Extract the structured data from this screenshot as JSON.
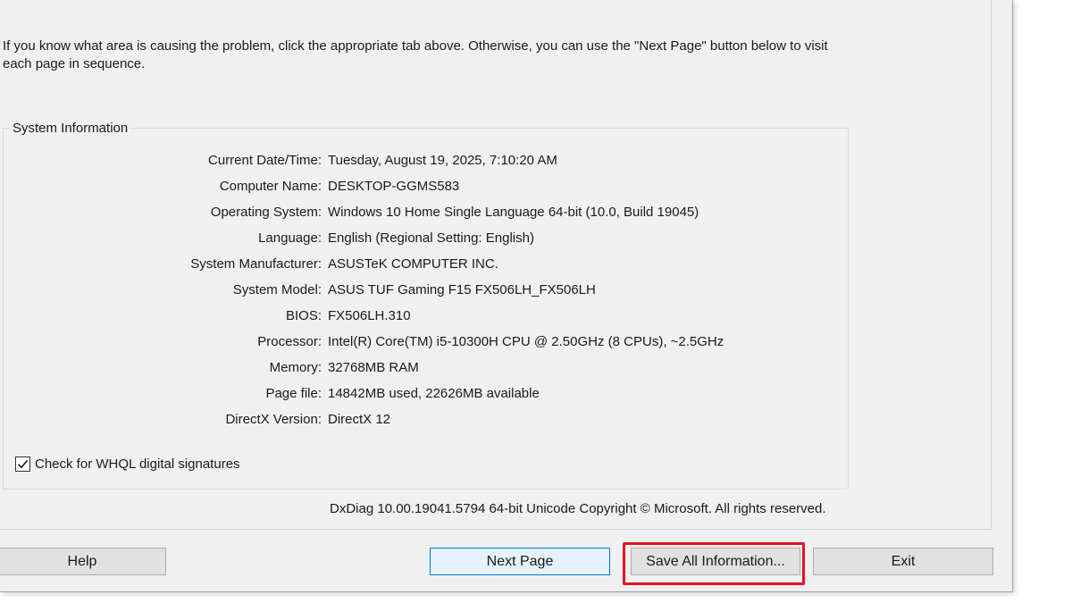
{
  "intro_text": "If you know what area is causing the problem, click the appropriate tab above.  Otherwise, you can use the \"Next Page\" button below to visit each page in sequence.",
  "system_info": {
    "group_title": "System Information",
    "rows": [
      {
        "label": "Current Date/Time:",
        "value": "Tuesday, August 19, 2025, 7:10:20 AM"
      },
      {
        "label": "Computer Name:",
        "value": "DESKTOP-GGMS583"
      },
      {
        "label": "Operating System:",
        "value": "Windows 10 Home Single Language 64-bit (10.0, Build 19045)"
      },
      {
        "label": "Language:",
        "value": "English (Regional Setting: English)"
      },
      {
        "label": "System Manufacturer:",
        "value": "ASUSTeK COMPUTER INC."
      },
      {
        "label": "System Model:",
        "value": "ASUS TUF Gaming F15 FX506LH_FX506LH"
      },
      {
        "label": "BIOS:",
        "value": "FX506LH.310"
      },
      {
        "label": "Processor:",
        "value": "Intel(R) Core(TM) i5-10300H CPU @ 2.50GHz (8 CPUs), ~2.5GHz"
      },
      {
        "label": "Memory:",
        "value": "32768MB RAM"
      },
      {
        "label": "Page file:",
        "value": "14842MB used, 22626MB available"
      },
      {
        "label": "DirectX Version:",
        "value": "DirectX 12"
      }
    ],
    "whql_label": "Check for WHQL digital signatures",
    "whql_checked": true
  },
  "footer": "DxDiag 10.00.19041.5794 64-bit Unicode  Copyright © Microsoft. All rights reserved.",
  "buttons": {
    "help": "Help",
    "next_page": "Next Page",
    "save_all": "Save All Information...",
    "exit": "Exit"
  },
  "colors": {
    "highlight": "#e81123",
    "default_button_border": "#0078d7"
  }
}
